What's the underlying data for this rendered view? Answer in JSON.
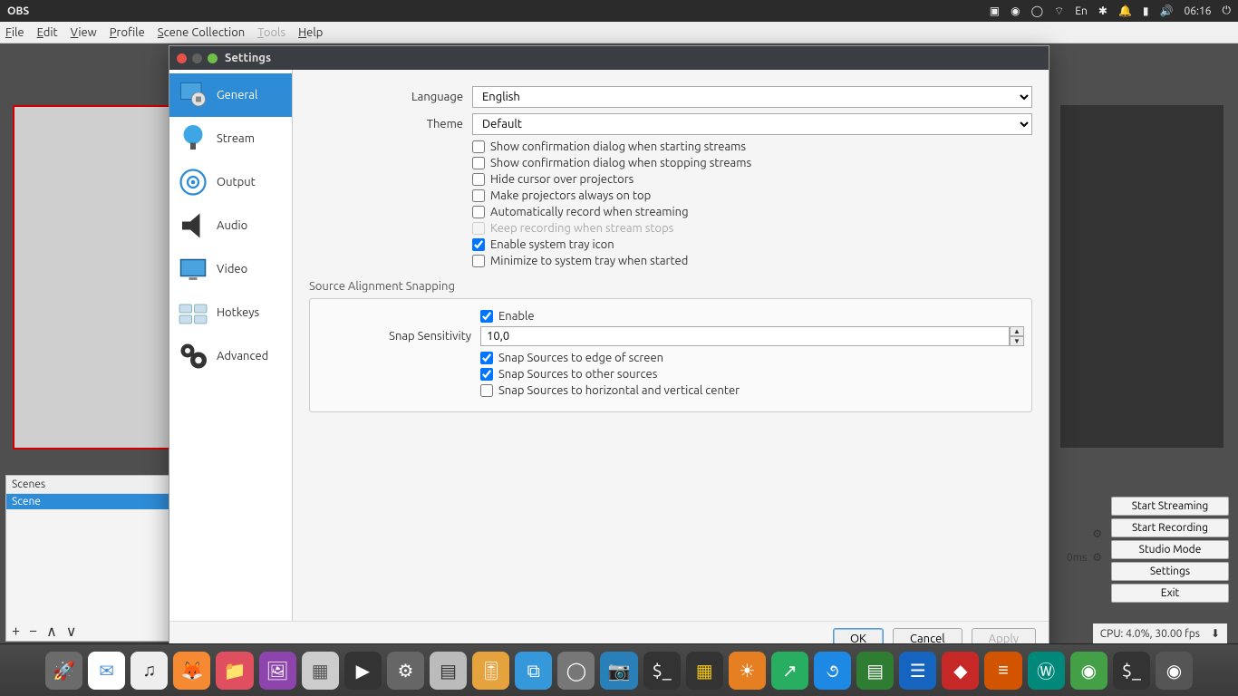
{
  "top_bar": {
    "app_name": "OBS",
    "lang": "En",
    "time": "06:16"
  },
  "menu_bar": {
    "items": [
      "File",
      "Edit",
      "View",
      "Profile",
      "Scene Collection",
      "Tools",
      "Help"
    ],
    "disabled_index": 5
  },
  "scenes_panel": {
    "title": "Scenes",
    "items": [
      "Scene"
    ]
  },
  "right_controls": {
    "start_streaming": "Start Streaming",
    "start_recording": "Start Recording",
    "studio_mode": "Studio Mode",
    "settings": "Settings",
    "exit": "Exit",
    "delay_text": "0ms"
  },
  "status_bar": {
    "cpu": "CPU: 4.0%, 30.00 fps"
  },
  "dialog": {
    "title": "Settings",
    "nav": [
      {
        "label": "General"
      },
      {
        "label": "Stream"
      },
      {
        "label": "Output"
      },
      {
        "label": "Audio"
      },
      {
        "label": "Video"
      },
      {
        "label": "Hotkeys"
      },
      {
        "label": "Advanced"
      }
    ],
    "general": {
      "language_label": "Language",
      "language_value": "English",
      "theme_label": "Theme",
      "theme_value": "Default",
      "checks": [
        {
          "label": "Show confirmation dialog when starting streams",
          "checked": false
        },
        {
          "label": "Show confirmation dialog when stopping streams",
          "checked": false
        },
        {
          "label": "Hide cursor over projectors",
          "checked": false
        },
        {
          "label": "Make projectors always on top",
          "checked": false
        },
        {
          "label": "Automatically record when streaming",
          "checked": false
        },
        {
          "label": "Keep recording when stream stops",
          "checked": false,
          "disabled": true
        },
        {
          "label": "Enable system tray icon",
          "checked": true
        },
        {
          "label": "Minimize to system tray when started",
          "checked": false
        }
      ]
    },
    "snapping": {
      "section_title": "Source Alignment Snapping",
      "enable_label": "Enable",
      "enable_checked": true,
      "sensitivity_label": "Snap Sensitivity",
      "sensitivity_value": "10,0",
      "checks": [
        {
          "label": "Snap Sources to edge of screen",
          "checked": true
        },
        {
          "label": "Snap Sources to other sources",
          "checked": true
        },
        {
          "label": "Snap Sources to horizontal and vertical center",
          "checked": false
        }
      ]
    },
    "buttons": {
      "ok": "OK",
      "cancel": "Cancel",
      "apply": "Apply"
    }
  }
}
